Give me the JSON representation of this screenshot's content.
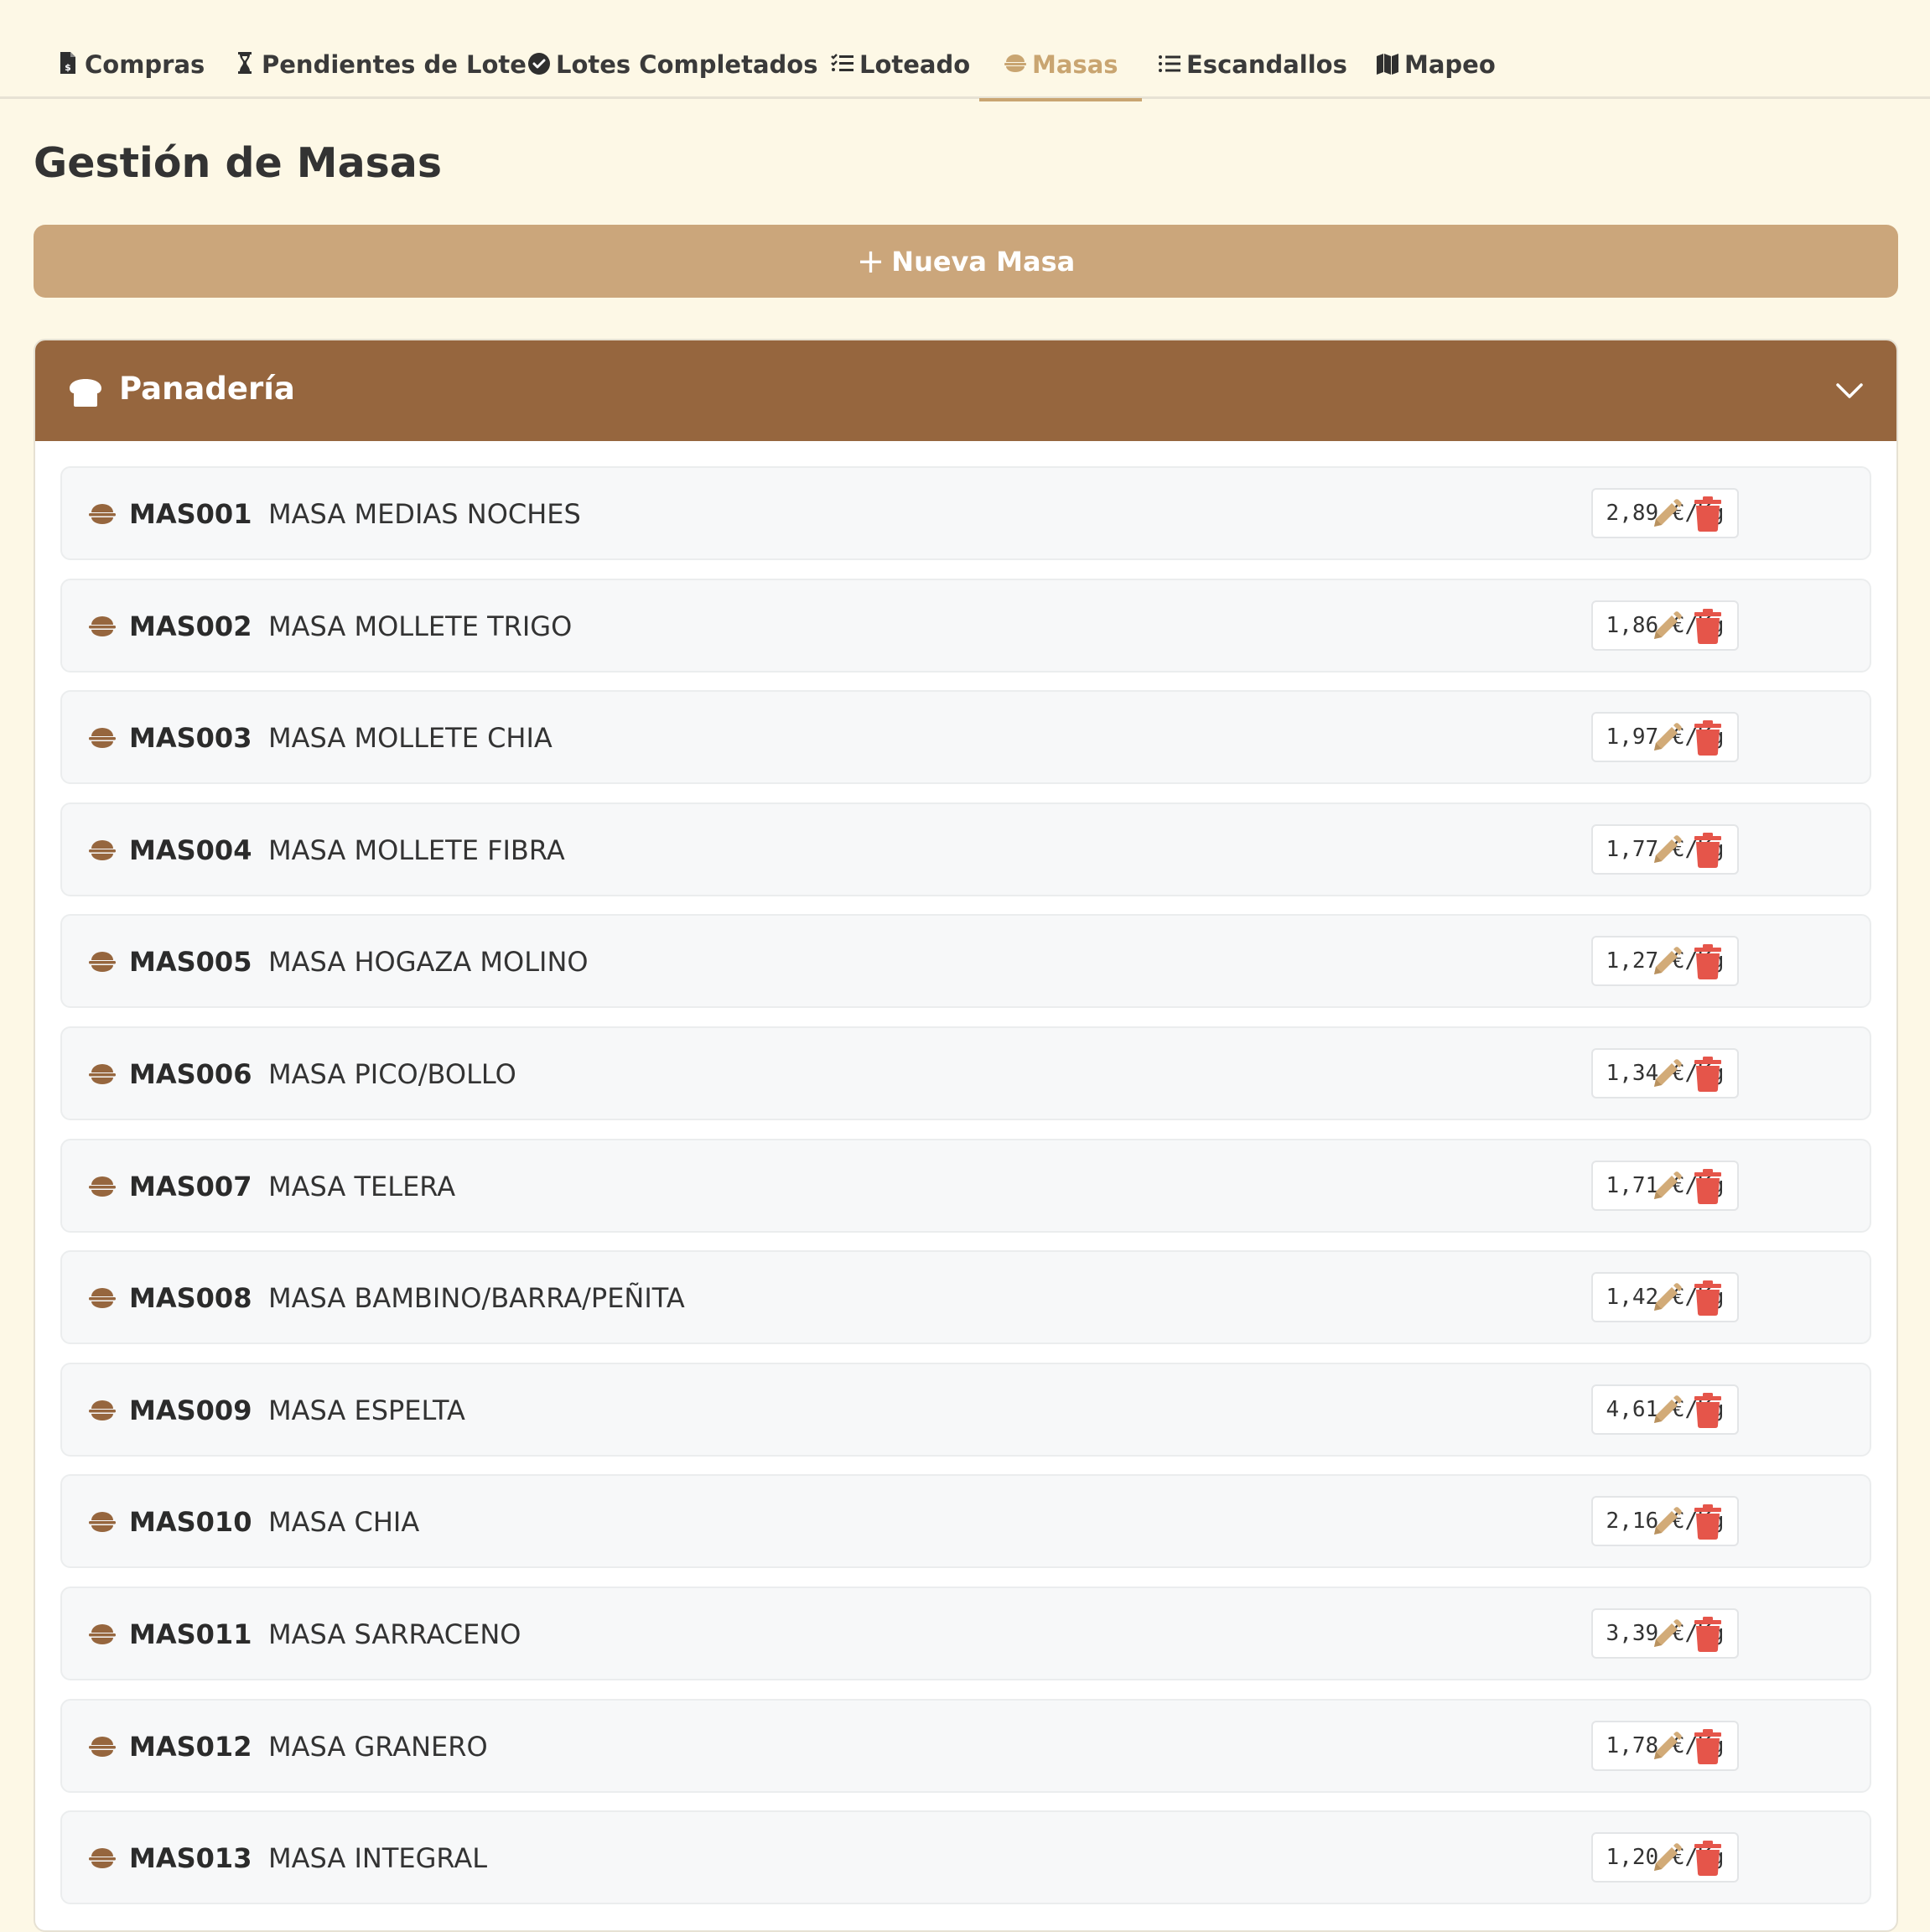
{
  "nav": {
    "tabs": [
      {
        "label": "Compras",
        "icon": "file-invoice-dollar-icon"
      },
      {
        "label": "Pendientes de Lote",
        "icon": "hourglass-icon"
      },
      {
        "label": "Lotes Completados",
        "icon": "check-circle-icon"
      },
      {
        "label": "Loteado",
        "icon": "checklist-icon"
      },
      {
        "label": "Masas",
        "icon": "bowl-icon",
        "active": true
      },
      {
        "label": "Escandallos",
        "icon": "list-icon"
      },
      {
        "label": "Mapeo",
        "icon": "map-icon"
      }
    ]
  },
  "page": {
    "title": "Gestión de Masas",
    "new_button_label": "Nueva Masa"
  },
  "category": {
    "label": "Panadería",
    "icon": "bread-icon"
  },
  "colors": {
    "accent": "#c9a571",
    "button": "#cba67b",
    "category_header": "#96663e",
    "delete": "#e5554a",
    "edit": "#d2ab78"
  },
  "items": [
    {
      "code": "MAS001",
      "name": "MASA MEDIAS NOCHES",
      "price": "2,89 €/Kg"
    },
    {
      "code": "MAS002",
      "name": "MASA MOLLETE TRIGO",
      "price": "1,86 €/Kg"
    },
    {
      "code": "MAS003",
      "name": "MASA MOLLETE CHIA",
      "price": "1,97 €/Kg"
    },
    {
      "code": "MAS004",
      "name": "MASA MOLLETE FIBRA",
      "price": "1,77 €/Kg"
    },
    {
      "code": "MAS005",
      "name": "MASA HOGAZA MOLINO",
      "price": "1,27 €/Kg"
    },
    {
      "code": "MAS006",
      "name": "MASA PICO/BOLLO",
      "price": "1,34 €/Kg"
    },
    {
      "code": "MAS007",
      "name": "MASA TELERA",
      "price": "1,71 €/Kg"
    },
    {
      "code": "MAS008",
      "name": "MASA BAMBINO/BARRA/PEÑITA",
      "price": "1,42 €/Kg"
    },
    {
      "code": "MAS009",
      "name": "MASA ESPELTA",
      "price": "4,61 €/Kg"
    },
    {
      "code": "MAS010",
      "name": "MASA CHIA",
      "price": "2,16 €/Kg"
    },
    {
      "code": "MAS011",
      "name": "MASA SARRACENO",
      "price": "3,39 €/Kg"
    },
    {
      "code": "MAS012",
      "name": "MASA GRANERO",
      "price": "1,78 €/Kg"
    },
    {
      "code": "MAS013",
      "name": "MASA INTEGRAL",
      "price": "1,20 €/Kg"
    }
  ]
}
